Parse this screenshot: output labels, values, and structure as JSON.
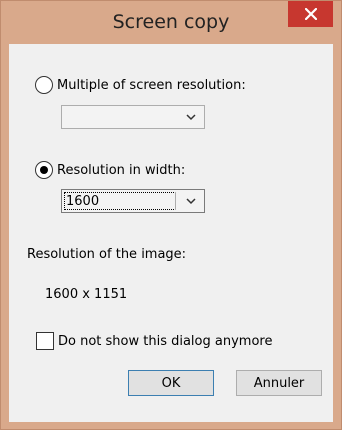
{
  "window": {
    "title": "Screen copy",
    "close_icon": "close-icon"
  },
  "options": {
    "multiple_label": "Multiple of screen resolution:",
    "multiple_checked": false,
    "multiple_value": "",
    "width_label": "Resolution in width:",
    "width_checked": true,
    "width_value": "1600"
  },
  "result": {
    "label": "Resolution of the image:",
    "value": "1600 x 1151"
  },
  "dont_show": {
    "label": "Do not show this dialog anymore",
    "checked": false
  },
  "buttons": {
    "ok": "OK",
    "cancel": "Annuler"
  },
  "colors": {
    "titlebar": "#d9a98b",
    "close": "#c7372f",
    "client": "#f0f0f0"
  }
}
